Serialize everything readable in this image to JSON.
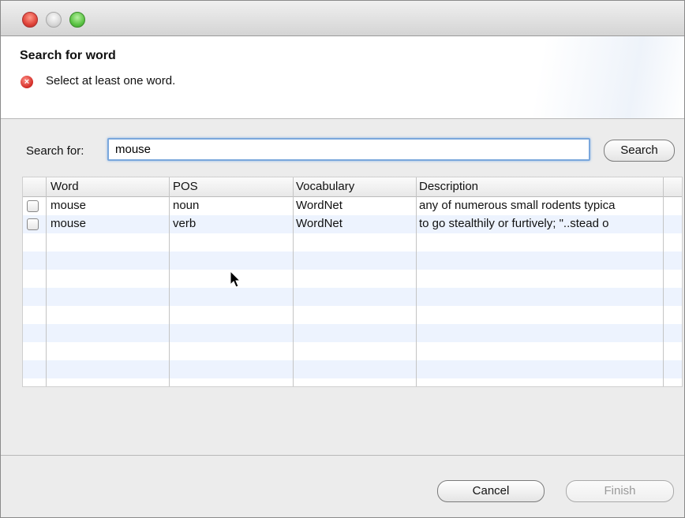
{
  "window": {
    "controls": [
      "close-icon",
      "minimize-icon",
      "zoom-icon"
    ]
  },
  "banner": {
    "title": "Search for word",
    "message": "Select at least one word.",
    "message_icon": "error-icon",
    "message_icon_glyph": "×"
  },
  "search": {
    "label": "Search for:",
    "value": "mouse",
    "button_label": "Search"
  },
  "table": {
    "columns": [
      "Word",
      "POS",
      "Vocabulary",
      "Description"
    ],
    "rows": [
      {
        "checked": false,
        "word": "mouse",
        "pos": "noun",
        "vocabulary": "WordNet",
        "description": "any of numerous small rodents typica"
      },
      {
        "checked": false,
        "word": "mouse",
        "pos": "verb",
        "vocabulary": "WordNet",
        "description": "to go stealthily or furtively; \"..stead o"
      }
    ],
    "row_stripe_color": "#edf3fe"
  },
  "footer": {
    "cancel_label": "Cancel",
    "finish_label": "Finish",
    "finish_enabled": false
  },
  "colors": {
    "error": "#d5302a",
    "focus_ring": "#7aa7dc"
  }
}
